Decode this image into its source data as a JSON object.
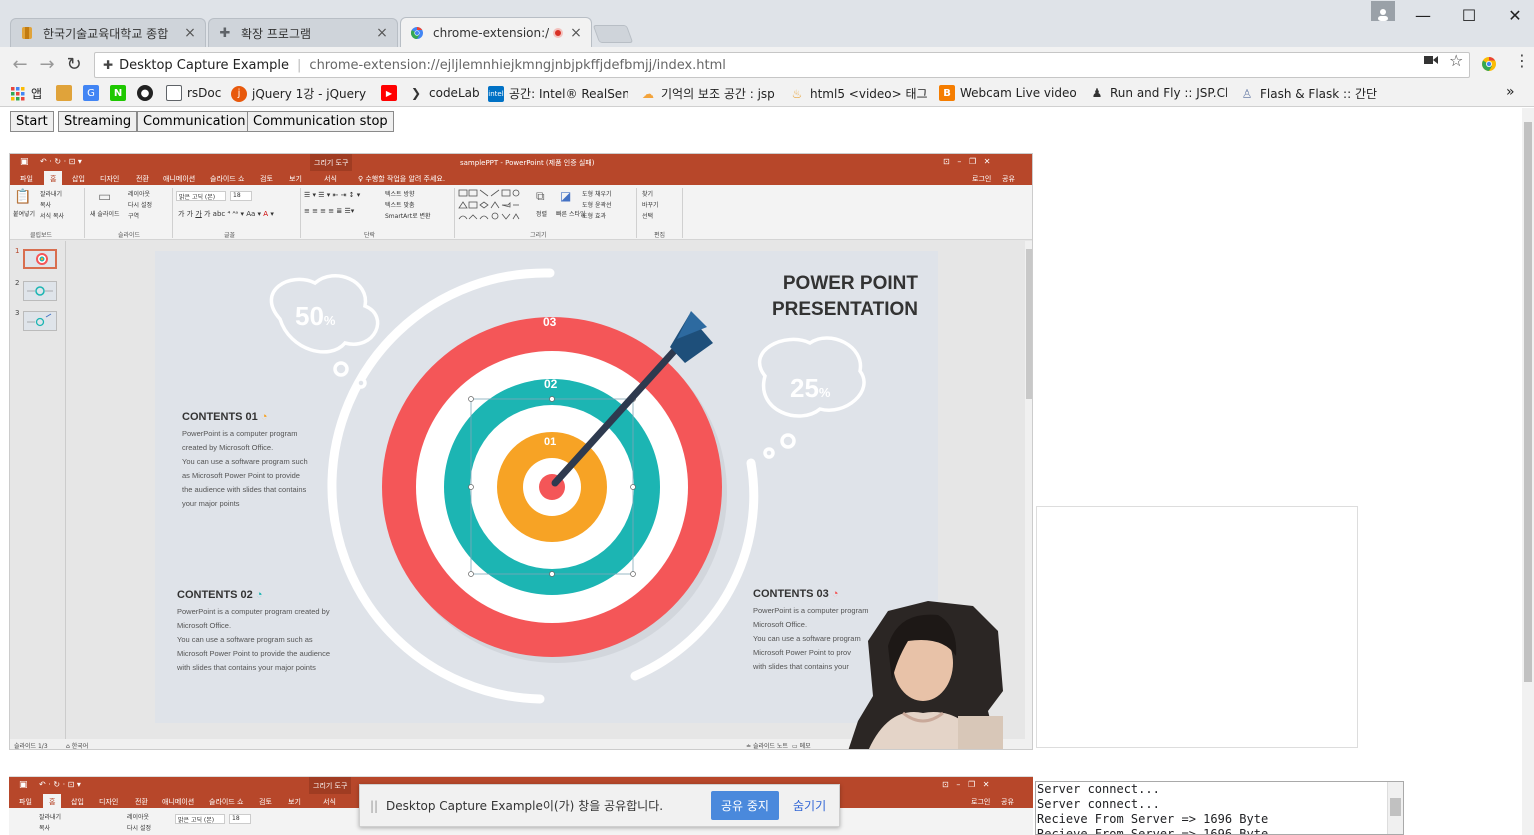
{
  "tabs": [
    {
      "label": "한국기술교육대학교 종합",
      "icon": "koreatech-icon",
      "close": "×"
    },
    {
      "label": "확장 프로그램",
      "icon": "puzzle-icon",
      "close": "×"
    },
    {
      "label": "chrome-extension://e",
      "icon": "chrome-icon",
      "close": "×"
    }
  ],
  "window": {
    "minimize": "—",
    "maximize": "☐",
    "close": "✕",
    "profile": "👤"
  },
  "toolbar": {
    "back": "←",
    "forward": "→",
    "reload": "↻",
    "site_name": "Desktop Capture Example",
    "separator": "|",
    "url": "chrome-extension://ejljlemnhiejkmngjnbjpkffjdefbmjj/index.html",
    "star": "☆",
    "camera": "■",
    "menu": "⋮"
  },
  "bookmarks": [
    {
      "label": "앱",
      "icon": "apps-grid-icon",
      "color": "#e8453c"
    },
    {
      "label": "",
      "icon": "koreatech-icon",
      "color": "#e0a33a"
    },
    {
      "label": "",
      "icon": "google-translate-icon",
      "color": "#4285f4"
    },
    {
      "label": "",
      "icon": "naver-icon",
      "color": "#1ec800"
    },
    {
      "label": "",
      "icon": "github-icon",
      "color": "#222222"
    },
    {
      "label": "rsDoc",
      "icon": "document-icon",
      "color": "#5f6368"
    },
    {
      "label": "jQuery 1강 - jQuery",
      "icon": "jquery-icon",
      "color": "#e8590c"
    },
    {
      "label": "",
      "icon": "youtube-icon",
      "color": "#ff0000"
    },
    {
      "label": "codeLab",
      "icon": "codelab-icon",
      "color": "#333333"
    },
    {
      "label": "공간: Intel® RealSens",
      "icon": "intel-icon",
      "color": "#0071c5"
    },
    {
      "label": "기억의 보조 공간 : jsp",
      "icon": "weather-icon",
      "color": "#f3a33a"
    },
    {
      "label": "html5 <video> 태그",
      "icon": "html5-icon",
      "color": "#e8a33a"
    },
    {
      "label": "Webcam Live video s",
      "icon": "blogger-icon",
      "color": "#f57d00"
    },
    {
      "label": "Run and Fly :: JSP.Ch",
      "icon": "run-icon",
      "color": "#333333"
    },
    {
      "label": "Flash & Flask :: 간단",
      "icon": "person-icon",
      "color": "#6b7fa8"
    }
  ],
  "bookmarks_more": "»",
  "page": {
    "buttons": [
      "Start",
      "Streaming",
      "Communication",
      "Communication stop"
    ]
  },
  "ppt": {
    "window_title": "samplePPT - PowerPoint (제품 인증 실패)",
    "drawing_tools": "그리기 도구",
    "menus": [
      "파일",
      "홈",
      "삽입",
      "디자인",
      "전환",
      "애니메이션",
      "슬라이드 쇼",
      "검토",
      "보기",
      "서식"
    ],
    "tell_me": "♀ 수행할 작업을 알려 주세요.",
    "login": "로그인",
    "share": "공유",
    "ribbon_groups": [
      "클립보드",
      "슬라이드",
      "글꼴",
      "단락",
      "그리기",
      "편집"
    ],
    "ribbon_items": [
      "붙여넣기",
      "잘라내기",
      "복사",
      "서식 복사",
      "새 슬라이드",
      "레이아웃",
      "다시 설정",
      "구역",
      "맑은 고딕 (본)",
      "18",
      "텍스트 방향",
      "텍스트 맞춤",
      "SmartArt로 변환",
      "정렬",
      "빠른 스타일",
      "도형 채우기",
      "도형 윤곽선",
      "도형 효과",
      "찾기",
      "바꾸기",
      "선택"
    ],
    "slide_numbers": [
      "1",
      "2",
      "3"
    ],
    "status": "슬라이드 1/3",
    "lang": "한국어",
    "notes": "슬라이드 노트",
    "memo": "메모"
  },
  "slide": {
    "title_line1": "POWER POINT",
    "title_line2": "PRESENTATION",
    "bubble_left": "50",
    "bubble_right": "25",
    "percent": "%",
    "ring_labels": [
      "03",
      "02",
      "01"
    ],
    "contents": [
      {
        "title": "CONTENTS 01",
        "body": "PowerPoint is a computer program\ncreated by Microsoft Office.\nYou can use a software program such\nas Microsoft Power Point to provide\nthe audience with slides that contains\nyour major points"
      },
      {
        "title": "CONTENTS 02",
        "body": "PowerPoint is a computer program created by\nMicrosoft Office.\nYou can use a software program such as\nMicrosoft Power Point to provide the audience\nwith slides that contains your major points"
      },
      {
        "title": "CONTENTS 03",
        "body": "PowerPoint is a computer program\nMicrosoft Office.\nYou can use a software program\nMicrosoft Power Point to prov\nwith slides that contains your"
      }
    ],
    "colors": {
      "red": "#f45658",
      "teal": "#1cb5b3",
      "orange": "#f7a325",
      "dart": "#1e4f7a",
      "bg": "#dfe3e9"
    }
  },
  "log": {
    "lines": [
      "Server connect...",
      "Server connect...",
      "Recieve From Server => 1696 Byte",
      "Recieve From Server => 1696 Byte"
    ]
  },
  "sharebar": {
    "grip": "||",
    "message": "Desktop Capture Example이(가) 창을 공유합니다.",
    "stop": "공유 중지",
    "hide": "숨기기"
  }
}
